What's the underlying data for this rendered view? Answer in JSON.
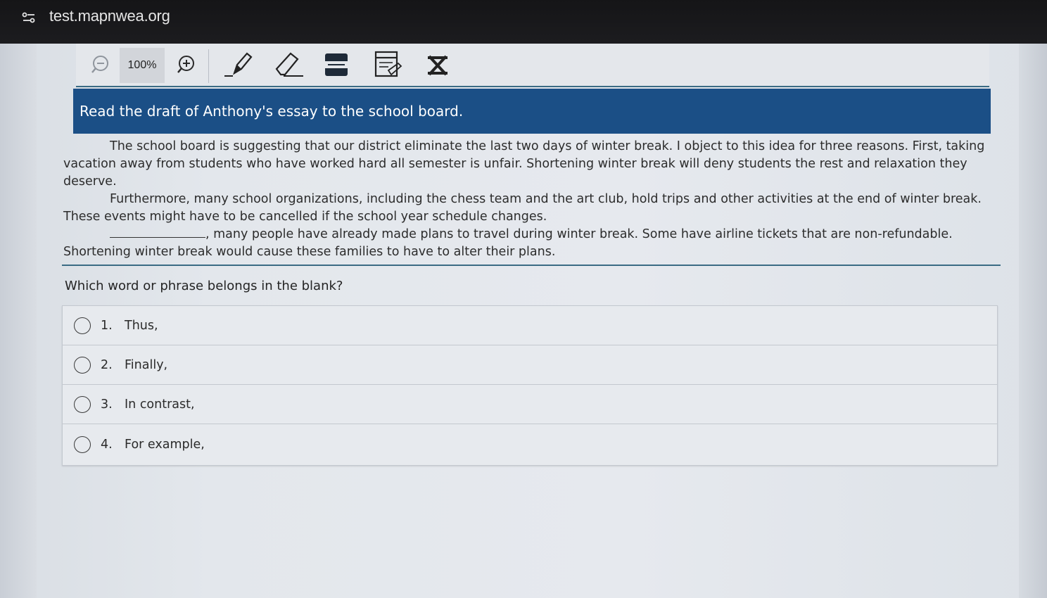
{
  "browser": {
    "url": "test.mapnwea.org"
  },
  "toolbar": {
    "zoom_level": "100%",
    "icons": [
      "zoom-out-icon",
      "zoom-in-icon",
      "highlighter-icon",
      "eraser-icon",
      "line-reader-icon",
      "notepad-icon",
      "answer-eliminator-icon"
    ]
  },
  "header": {
    "instruction": "Read the draft of Anthony's essay to the school board."
  },
  "passage": {
    "paragraph_1": "The school board is suggesting that our district eliminate the last two days of winter break. I object to this idea for three reasons. First, taking vacation away from students who have worked hard all semester is unfair. Shortening winter break will deny students the rest and relaxation they deserve.",
    "paragraph_2": "Furthermore, many school organizations, including the chess team and the art club, hold trips and other activities at the end of winter break. These events might have to be cancelled if the school year schedule changes.",
    "paragraph_3": ", many people have already made plans to travel during winter break. Some have airline tickets that are non-refundable. Shortening winter break would cause these families to have to alter their plans."
  },
  "question": {
    "text": "Which word or phrase belongs in the blank?"
  },
  "choices": [
    {
      "number": "1.",
      "text": "Thus,"
    },
    {
      "number": "2.",
      "text": "Finally,"
    },
    {
      "number": "3.",
      "text": "In contrast,"
    },
    {
      "number": "4.",
      "text": "For example,"
    }
  ],
  "colors": {
    "banner": "#1b4f86",
    "accent_line": "#3a6b84",
    "page_background": "#e3e7ec"
  }
}
